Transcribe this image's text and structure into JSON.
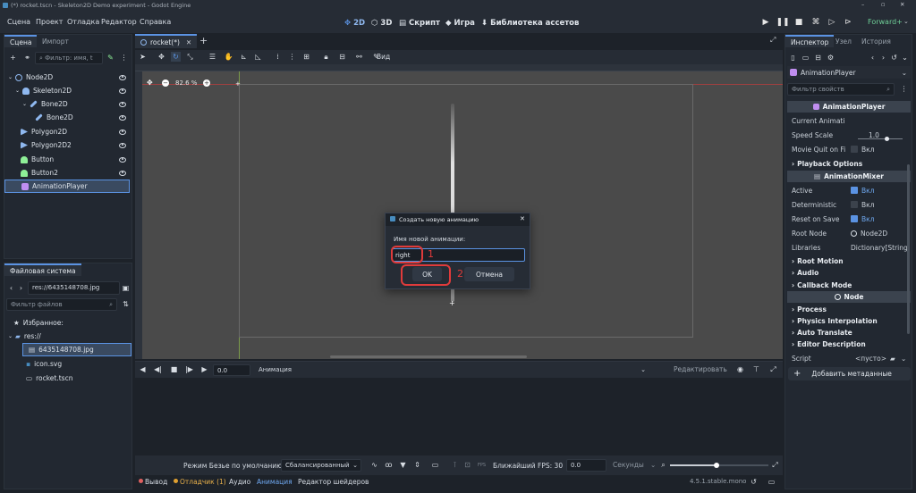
{
  "window": {
    "title": "(*) rocket.tscn - Skeleton2D Demo experiment - Godot Engine"
  },
  "menu": [
    "Сцена",
    "Проект",
    "Отладка",
    "Редактор",
    "Справка"
  ],
  "modes": [
    "2D",
    "3D",
    "Скрипт",
    "Игра",
    "Библиотека ассетов"
  ],
  "renderer": "Forward+",
  "scene_dock": {
    "tabs": [
      "Сцена",
      "Импорт"
    ],
    "filter_placeholder": "Фильтр: имя, t",
    "nodes": [
      "Node2D",
      "Skeleton2D",
      "Bone2D",
      "Bone2D",
      "Polygon2D",
      "Polygon2D2",
      "Button",
      "Button2",
      "AnimationPlayer"
    ]
  },
  "filesystem": {
    "tab": "Файловая система",
    "path": "res://6435148708.jpg",
    "filter_placeholder": "Фильтр файлов",
    "favorites": "Избранное:",
    "root": "res://",
    "files": [
      "6435148708.jpg",
      "icon.svg",
      "rocket.tscn"
    ]
  },
  "editor": {
    "tab": "rocket(*)",
    "zoom": "82.6 %",
    "view_label": "Вид"
  },
  "dialog": {
    "title": "Создать новую анимацию",
    "label": "Имя новой анимации:",
    "value": "right",
    "ok": "OK",
    "cancel": "Отмена",
    "marker1": "1",
    "marker2": "2"
  },
  "anim_panel": {
    "time": "0.0",
    "anim_label": "Анимация",
    "edit": "Редактировать",
    "bezier_label": "Режим Безье по умолчанию:",
    "bezier_value": "Сбалансированный",
    "fps_label": "Ближайший FPS: 30",
    "fps_value": "0.0",
    "unit": "Секунды"
  },
  "bottom_tabs": [
    "Вывод",
    "Отладчик (1)",
    "Аудио",
    "Анимация",
    "Редактор шейдеров"
  ],
  "version": "4.5.1.stable.mono",
  "inspector": {
    "tabs": [
      "Инспектор",
      "Узел",
      "История"
    ],
    "object": "AnimationPlayer",
    "filter_placeholder": "Фильтр свойств",
    "section1": "AnimationPlayer",
    "current_anim": "Current Animati",
    "speed_label": "Speed Scale",
    "speed_value": "1.0",
    "movie_label": "Movie Quit on Fi",
    "on_label": "Вкл",
    "playback": "Playback Options",
    "section2": "AnimationMixer",
    "active": "Active",
    "deterministic": "Deterministic",
    "reset_on_save": "Reset on Save",
    "root_node": "Root Node",
    "root_node_value": "Node2D",
    "libraries": "Libraries",
    "libraries_value": "Dictionary[String",
    "groups": [
      "Root Motion",
      "Audio",
      "Callback Mode"
    ],
    "section3": "Node",
    "groups2": [
      "Process",
      "Physics Interpolation",
      "Auto Translate",
      "Editor Description"
    ],
    "script": "Script",
    "script_value": "<пусто>",
    "add_meta": "Добавить метаданные"
  },
  "colors": {
    "accent": "#5b93e3",
    "highlight": "#e03b3b"
  }
}
